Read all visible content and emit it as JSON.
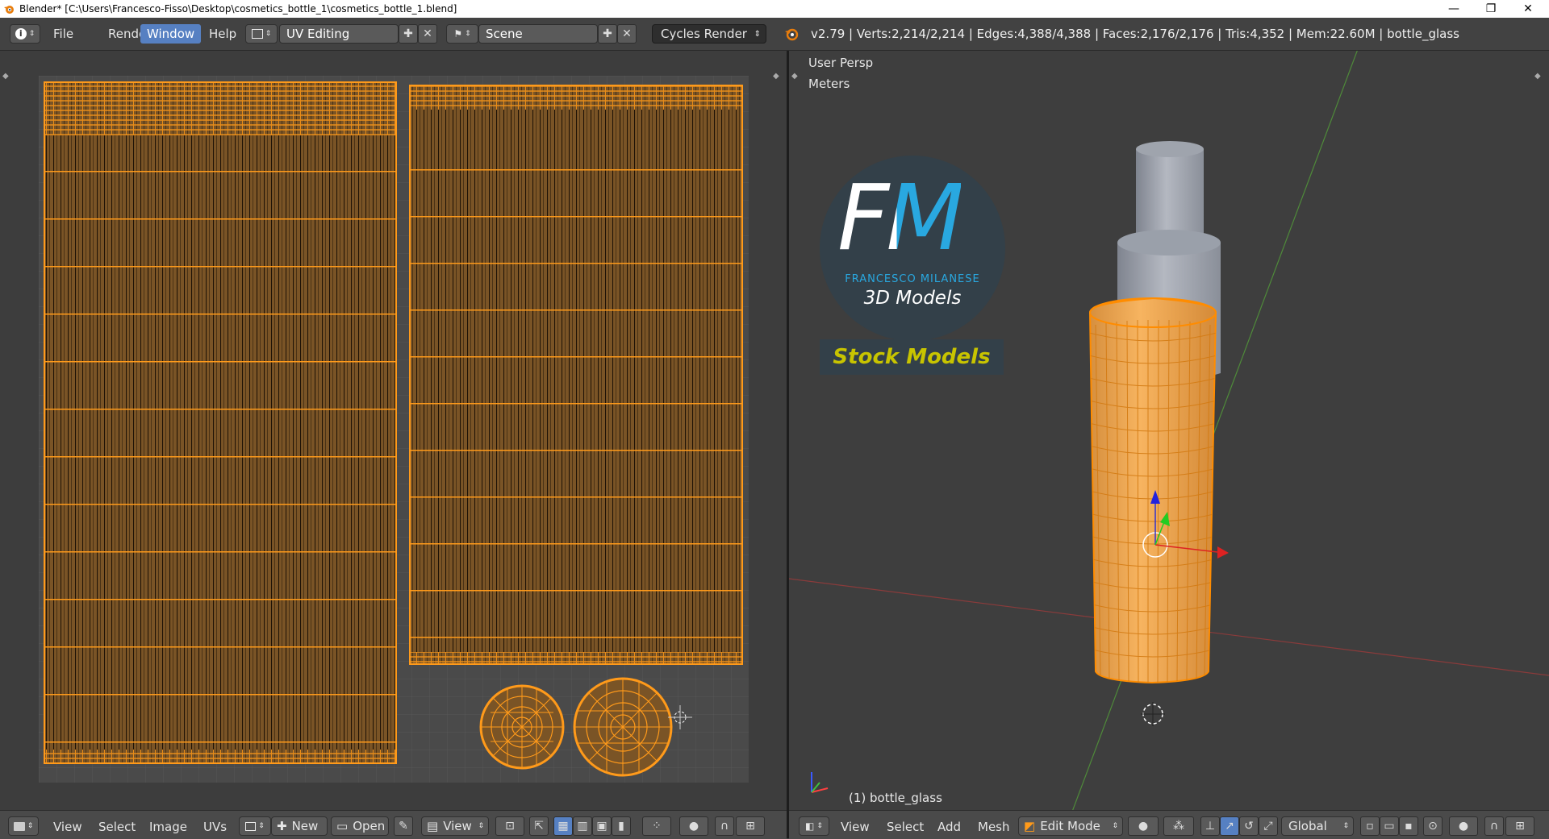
{
  "window": {
    "title": "Blender* [C:\\Users\\Francesco-Fisso\\Desktop\\cosmetics_bottle_1\\cosmetics_bottle_1.blend]",
    "controls": {
      "minimize": "—",
      "restore": "❐",
      "close": "✕"
    }
  },
  "info_header": {
    "menus": [
      {
        "label": "File"
      },
      {
        "label": "Render"
      },
      {
        "label": "Window"
      },
      {
        "label": "Help"
      }
    ],
    "active_menu": "Window",
    "screen_layout": "UV Editing",
    "scene": "Scene",
    "render_engine": "Cycles Render",
    "stats": "v2.79 | Verts:2,214/2,214 | Edges:4,388/4,388 | Faces:2,176/2,176 | Tris:4,352 | Mem:22.60M | bottle_glass"
  },
  "uv_editor": {
    "menus": [
      "View",
      "Select",
      "Image",
      "UVs"
    ],
    "new_label": "New",
    "open_label": "Open",
    "view_label": "View"
  },
  "viewport": {
    "view_name": "User Persp",
    "units": "Meters",
    "object_label": "(1) bottle_glass",
    "menus": [
      "View",
      "Select",
      "Add",
      "Mesh"
    ],
    "mode": "Edit Mode",
    "orientation": "Global"
  },
  "logo": {
    "initials": "FM",
    "author": "FRANCESCO MILANESE",
    "subtitle": "3D Models",
    "tag": "Stock Models"
  },
  "colors": {
    "accent_orange": "#ff8c00",
    "menu_active": "#5680c2",
    "logo_blue": "#29a8e0",
    "logo_tag": "#c8c400"
  }
}
